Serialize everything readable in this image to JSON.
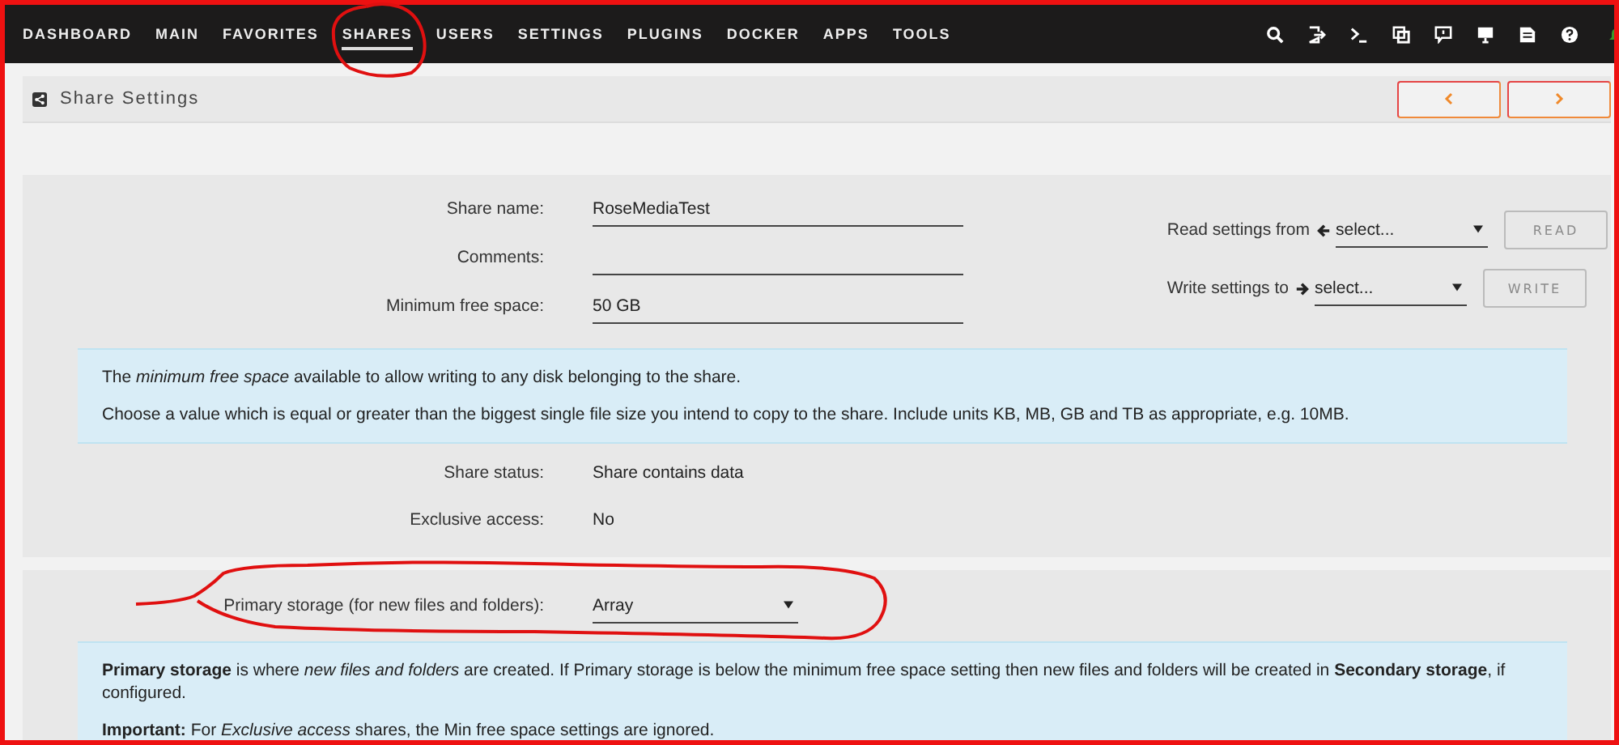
{
  "nav": [
    {
      "label": "DASHBOARD",
      "selected": false
    },
    {
      "label": "MAIN",
      "selected": false
    },
    {
      "label": "FAVORITES",
      "selected": false
    },
    {
      "label": "SHARES",
      "selected": true
    },
    {
      "label": "USERS",
      "selected": false
    },
    {
      "label": "SETTINGS",
      "selected": false
    },
    {
      "label": "PLUGINS",
      "selected": false
    },
    {
      "label": "DOCKER",
      "selected": false
    },
    {
      "label": "APPS",
      "selected": false
    },
    {
      "label": "TOOLS",
      "selected": false
    }
  ],
  "header": {
    "title": "Share Settings"
  },
  "fields": [
    {
      "label": "Share name:",
      "value": "RoseMediaTest"
    },
    {
      "label": "Comments:"
    },
    {
      "label": "Minimum free space:",
      "value": "50 GB"
    }
  ],
  "copy_settings": [
    {
      "label": "Read settings from",
      "kind": "read",
      "value": "select...",
      "button": "READ",
      "disabled": true
    },
    {
      "label": "Write settings to",
      "kind": "write",
      "value": "select...",
      "button": "WRITE",
      "disabled": true
    }
  ],
  "free_space_help": [
    "The *minimum free space* available to allow writing to any disk belonging to the share.",
    "Choose a value which is equal or greater than the biggest single file size you intend to copy to the share. Include units KB, MB, GB and TB as appropriate, e.g. 10MB."
  ],
  "status_rows": [
    {
      "label": "Share status:",
      "value": "Share contains data"
    },
    {
      "label": "Exclusive access:",
      "value": "No"
    }
  ],
  "primary_storage": {
    "label": "Primary storage (for new files and folders):",
    "value": "Array"
  },
  "storage_help": [
    "**Primary storage** is where *new files and folders* are created. If Primary storage is below the minimum free space setting then new files and folders will be created in **Secondary storage**, if configured.",
    "**Important:** For *Exclusive access* shares, the Min free space settings are ignored."
  ]
}
